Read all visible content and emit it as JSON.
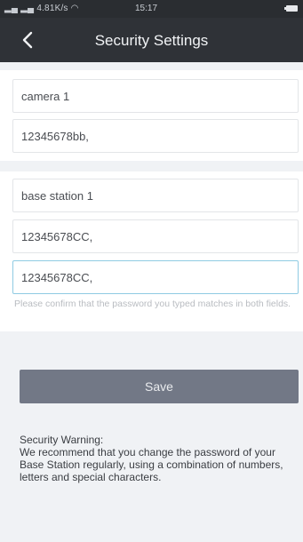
{
  "status_bar": {
    "left": "信📶 信 4.81K/s",
    "network_text": "4.81K/s",
    "time": "15:17"
  },
  "header": {
    "title": "Security Settings",
    "back_icon": "chevron-left-icon"
  },
  "camera": {
    "name": "camera 1",
    "password": "12345678bb,"
  },
  "base_station": {
    "name": "base station 1",
    "password": "12345678CC,",
    "confirm_password": "12345678CC,",
    "hint": "Please confirm that the password you typed matches in both fields."
  },
  "actions": {
    "save_label": "Save"
  },
  "warning": {
    "title": "Security Warning:",
    "body": "We recommend that you change the password of your Base Station regularly, using a combination of numbers, letters and special characters."
  },
  "colors": {
    "header_bg": "#2f3237",
    "page_bg": "#f0f2f5",
    "save_button_bg": "#727886",
    "active_field_border": "#8fcbe2"
  }
}
